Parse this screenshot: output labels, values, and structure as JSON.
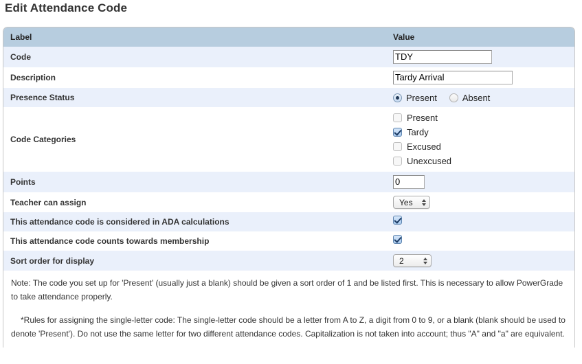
{
  "page": {
    "title": "Edit Attendance Code"
  },
  "table": {
    "headers": {
      "label": "Label",
      "value": "Value"
    },
    "rows": {
      "code": {
        "label": "Code",
        "value": "TDY"
      },
      "description": {
        "label": "Description",
        "value": "Tardy Arrival"
      },
      "presence_status": {
        "label": "Presence Status",
        "options": [
          {
            "label": "Present",
            "selected": true
          },
          {
            "label": "Absent",
            "selected": false
          }
        ]
      },
      "code_categories": {
        "label": "Code Categories",
        "options": [
          {
            "label": "Present",
            "checked": false
          },
          {
            "label": "Tardy",
            "checked": true
          },
          {
            "label": "Excused",
            "checked": false
          },
          {
            "label": "Unexcused",
            "checked": false
          }
        ]
      },
      "points": {
        "label": "Points",
        "value": "0"
      },
      "teacher_can_assign": {
        "label": "Teacher can assign",
        "value": "Yes"
      },
      "ada": {
        "label": "This attendance code is considered in ADA calculations",
        "checked": true
      },
      "membership": {
        "label": "This attendance code counts towards membership",
        "checked": true
      },
      "sort_order": {
        "label": "Sort order for display",
        "value": "2"
      }
    }
  },
  "notes": {
    "note1": "Note: The code you set up for 'Present' (usually just a blank) should be given a sort order of 1 and be listed first. This is necessary to allow PowerGrade to take attendance properly.",
    "note2": "*Rules for assigning the single-letter code: The single-letter code should be a letter from A to Z, a digit from 0 to 9, or a blank (blank should be used to denote 'Present'). Do not use the same letter for two different attendance codes. Capitalization is not taken into account; thus \"A\" and \"a\" are equivalent."
  },
  "colors": {
    "header_bg": "#b7cddf",
    "row_alt_bg": "#eaf0fb",
    "row_plain_bg": "#ffffff",
    "border": "#c6c6c6",
    "text": "#333333"
  }
}
